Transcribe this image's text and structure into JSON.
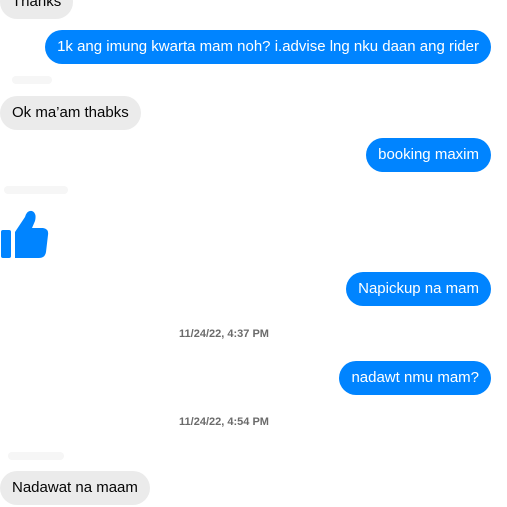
{
  "conversation": {
    "messages": [
      {
        "direction": "incoming",
        "text": "Thanks"
      },
      {
        "direction": "outgoing",
        "text": "1k ang imung kwarta mam noh? i.advise lng nku daan ang rider"
      },
      {
        "direction": "incoming",
        "text": "Ok ma’am thabks"
      },
      {
        "direction": "outgoing",
        "text": "booking maxim"
      },
      {
        "direction": "incoming",
        "icon": "thumbs-up-icon"
      },
      {
        "direction": "outgoing",
        "text": "Napickup na mam"
      },
      {
        "direction": "outgoing",
        "text": "nadawt nmu mam?"
      },
      {
        "direction": "incoming",
        "text": "Nadawat na maam"
      }
    ],
    "timestamps": [
      "11/24/22, 4:37 PM",
      "11/24/22, 4:54 PM"
    ]
  },
  "colors": {
    "outgoing_bubble": "#0084ff",
    "incoming_bubble": "#ebebeb",
    "thumbs_up": "#0084ff"
  }
}
